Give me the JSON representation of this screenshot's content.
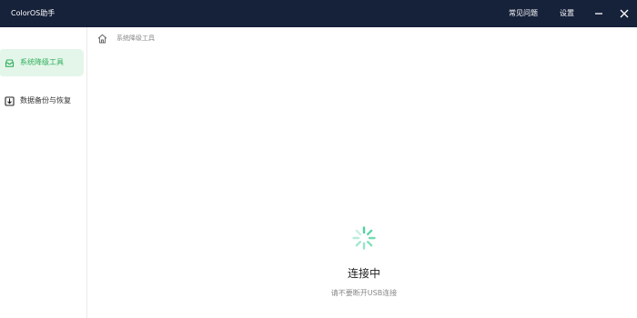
{
  "app": {
    "title": "ColorOS助手"
  },
  "titlebar": {
    "faq": "常见问题",
    "settings": "设置",
    "minimize_icon": "minimize-icon",
    "close_icon": "close-icon"
  },
  "sidebar": {
    "items": [
      {
        "label": "系统降级工具",
        "icon": "downgrade-icon",
        "active": true
      },
      {
        "label": "数据备份与恢复",
        "icon": "backup-icon",
        "active": false
      }
    ]
  },
  "breadcrumb": {
    "home_icon": "home-icon",
    "current": "系统降级工具"
  },
  "status": {
    "title": "连接中",
    "subtitle": "请不要断开USB连接"
  },
  "colors": {
    "titlebar": "#16213a",
    "accent": "#2fae5b",
    "active_bg": "#e3f6e9",
    "spinner": "#4fd3a0"
  }
}
